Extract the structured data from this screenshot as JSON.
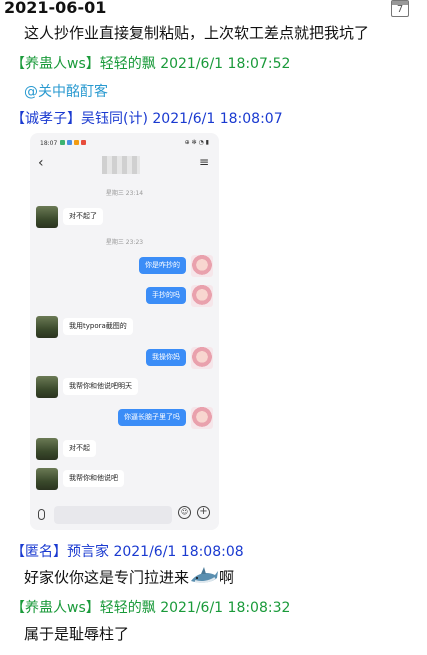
{
  "date": "2021-06-01",
  "calendar_day": "7",
  "messages": [
    {
      "text": "这人抄作业直接复制粘贴，上次软工差点就把我坑了"
    },
    {
      "tag": "【养蛊人ws】",
      "sender": "轻轻的飘",
      "time": "2021/6/1 18:07:52",
      "mention": "@关中酩酊客"
    },
    {
      "tag": "【诚孝子】",
      "sender": "吴钰同(计)",
      "time": "2021/6/1 18:08:07"
    },
    {
      "tag": "【匿名】",
      "sender": "预言家",
      "time": "2021/6/1 18:08:08",
      "text": "好家伙你这是专门拉进来",
      "text_after": "啊"
    },
    {
      "tag": "【养蛊人ws】",
      "sender": "轻轻的飘",
      "time": "2021/6/1 18:08:32",
      "text": "属于是耻辱柱了"
    }
  ],
  "phone": {
    "status_time": "18:07",
    "status_right": "⊕ ✻ ◔ ▮",
    "back": "‹",
    "menu": "≡",
    "ts1": "星期三 23:14",
    "ts2": "星期三 23:23",
    "chat": [
      {
        "side": "left",
        "text": "对不起了"
      },
      {
        "side": "right",
        "text": "你是咋抄的"
      },
      {
        "side": "right",
        "text": "手抄的吗"
      },
      {
        "side": "left",
        "text": "我用typora截图的"
      },
      {
        "side": "right",
        "text": "我操你妈"
      },
      {
        "side": "left",
        "text": "我帮你和他说吧明天"
      },
      {
        "side": "right",
        "text": "你逼长脑子里了吗"
      },
      {
        "side": "left",
        "text": "对不起"
      },
      {
        "side": "left",
        "text": "我帮你和他说吧"
      }
    ],
    "emoji_icon": "☺",
    "plus_icon": "+"
  },
  "colors": {
    "tag_green": "#1a9a3a",
    "tag_blue": "#1a3ad0",
    "mention": "#2a9ad0",
    "bubble_right": "#3b8df7"
  }
}
